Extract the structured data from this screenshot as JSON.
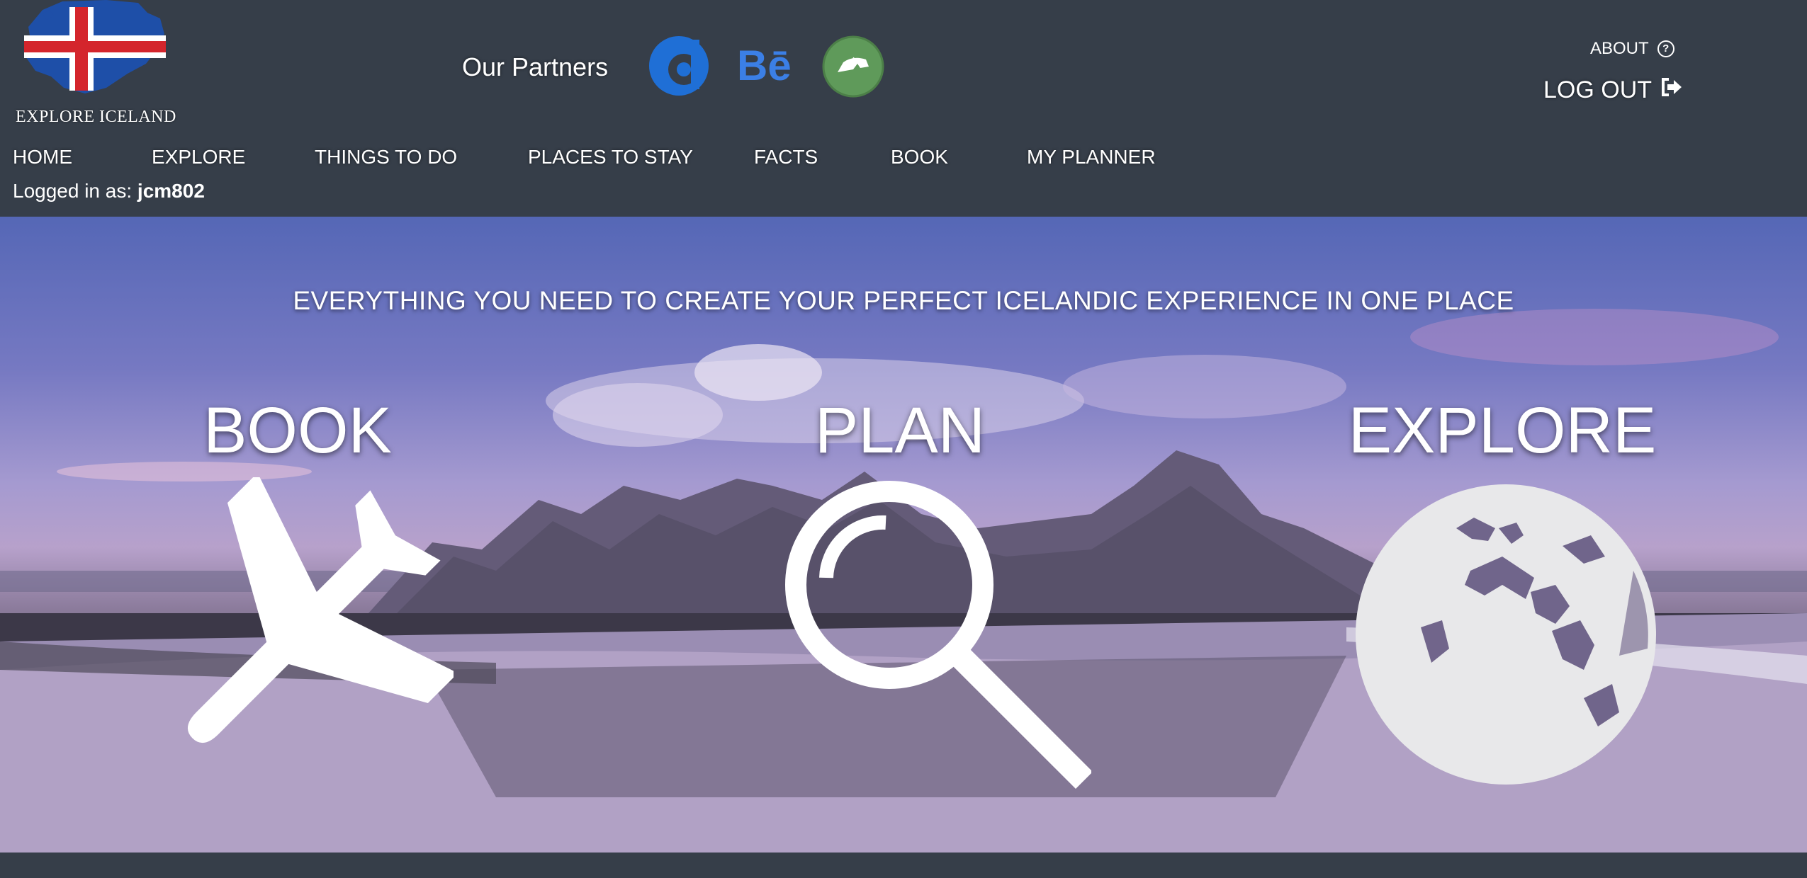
{
  "brand": {
    "name": "EXPLORE ICELAND",
    "logo": "iceland-flag-map-icon"
  },
  "partners": {
    "label": "Our Partners",
    "items": [
      {
        "name": "dailymotion",
        "icon": "dailymotion-icon"
      },
      {
        "name": "behance",
        "icon": "behance-icon",
        "text": "Bē"
      },
      {
        "name": "deviantart",
        "icon": "devianart-icon"
      }
    ]
  },
  "account": {
    "about_label": "ABOUT",
    "about_icon": "question-circle-icon",
    "logout_label": "LOG OUT",
    "logout_icon": "sign-out-icon",
    "logged_in_prefix": "Logged in as:",
    "username": "jcm802"
  },
  "nav": {
    "items": [
      {
        "label": "HOME"
      },
      {
        "label": "EXPLORE"
      },
      {
        "label": "THINGS TO DO"
      },
      {
        "label": "PLACES TO STAY"
      },
      {
        "label": "FACTS"
      },
      {
        "label": "BOOK"
      },
      {
        "label": "MY PLANNER"
      }
    ]
  },
  "hero": {
    "tagline": "EVERYTHING YOU NEED TO CREATE YOUR PERFECT ICELANDIC EXPERIENCE IN ONE PLACE",
    "features": [
      {
        "title": "BOOK",
        "icon": "airplane-icon"
      },
      {
        "title": "PLAN",
        "icon": "magnifying-glass-icon"
      },
      {
        "title": "EXPLORE",
        "icon": "globe-icon"
      }
    ]
  },
  "colors": {
    "header_bg": "#363e49",
    "text": "#ffffff",
    "flag_blue": "#1e4fa8",
    "flag_red": "#d4252c",
    "behance_blue": "#3b7fe6",
    "deviantart_green": "#5f9a5a"
  }
}
